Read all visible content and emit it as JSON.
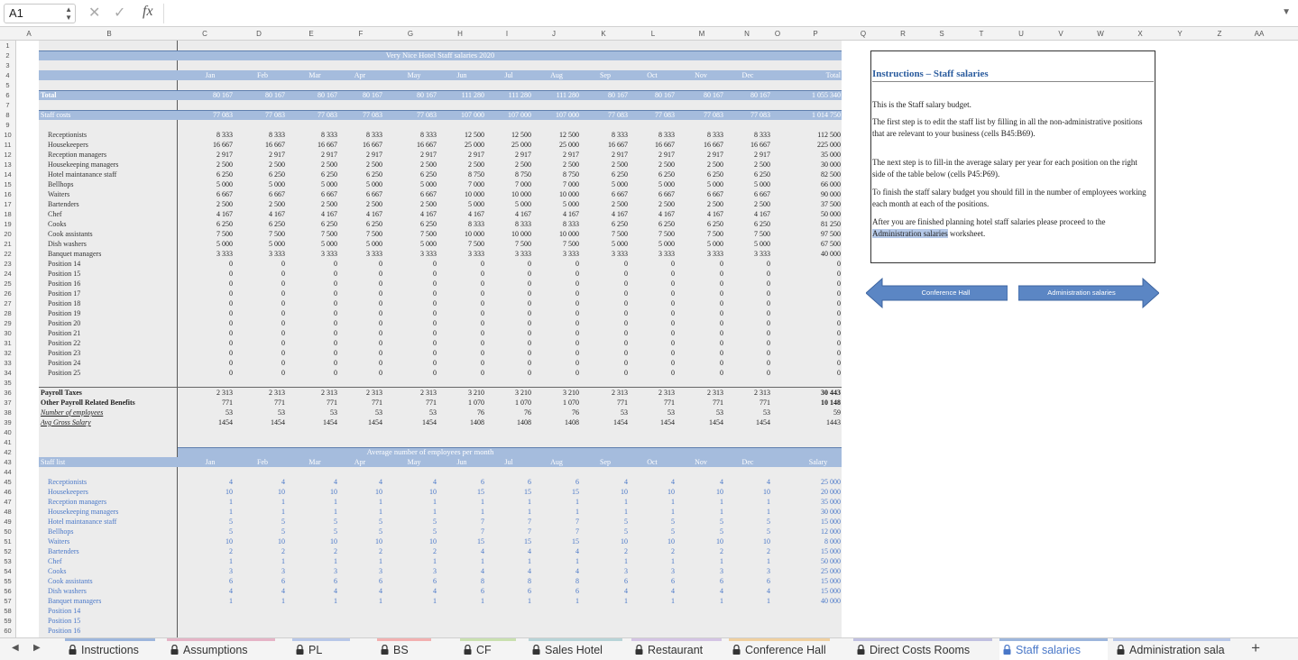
{
  "formula_bar": {
    "cell_ref": "A1",
    "formula": ""
  },
  "columns": [
    "A",
    "B",
    "C",
    "D",
    "E",
    "F",
    "G",
    "H",
    "I",
    "J",
    "K",
    "L",
    "M",
    "N",
    "O",
    "P",
    "Q",
    "R",
    "S",
    "T",
    "U",
    "V",
    "W",
    "X",
    "Y",
    "Z",
    "AA"
  ],
  "budget": {
    "title": "Very Nice Hotel Staff salaries 2020",
    "months": [
      "Jan",
      "Feb",
      "Mar",
      "Apr",
      "May",
      "Jun",
      "Jul",
      "Aug",
      "Sep",
      "Oct",
      "Nov",
      "Dec",
      "Total"
    ],
    "total_label": "Total",
    "total_values": [
      "80 167",
      "80 167",
      "80 167",
      "80 167",
      "80 167",
      "111 280",
      "111 280",
      "111 280",
      "80 167",
      "80 167",
      "80 167",
      "80 167",
      "1 055 340"
    ],
    "staff_costs_label": "Staff costs",
    "staff_costs_values": [
      "77 083",
      "77 083",
      "77 083",
      "77 083",
      "77 083",
      "107 000",
      "107 000",
      "107 000",
      "77 083",
      "77 083",
      "77 083",
      "77 083",
      "1 014 750"
    ],
    "rows": [
      {
        "label": "Receptionists",
        "v": [
          "8 333",
          "8 333",
          "8 333",
          "8 333",
          "8 333",
          "12 500",
          "12 500",
          "12 500",
          "8 333",
          "8 333",
          "8 333",
          "8 333",
          "112 500"
        ]
      },
      {
        "label": "Housekeepers",
        "v": [
          "16 667",
          "16 667",
          "16 667",
          "16 667",
          "16 667",
          "25 000",
          "25 000",
          "25 000",
          "16 667",
          "16 667",
          "16 667",
          "16 667",
          "225 000"
        ]
      },
      {
        "label": "Reception managers",
        "v": [
          "2 917",
          "2 917",
          "2 917",
          "2 917",
          "2 917",
          "2 917",
          "2 917",
          "2 917",
          "2 917",
          "2 917",
          "2 917",
          "2 917",
          "35 000"
        ]
      },
      {
        "label": "Housekeeping managers",
        "v": [
          "2 500",
          "2 500",
          "2 500",
          "2 500",
          "2 500",
          "2 500",
          "2 500",
          "2 500",
          "2 500",
          "2 500",
          "2 500",
          "2 500",
          "30 000"
        ]
      },
      {
        "label": "Hotel maintanance staff",
        "v": [
          "6 250",
          "6 250",
          "6 250",
          "6 250",
          "6 250",
          "8 750",
          "8 750",
          "8 750",
          "6 250",
          "6 250",
          "6 250",
          "6 250",
          "82 500"
        ]
      },
      {
        "label": "Bellhops",
        "v": [
          "5 000",
          "5 000",
          "5 000",
          "5 000",
          "5 000",
          "7 000",
          "7 000",
          "7 000",
          "5 000",
          "5 000",
          "5 000",
          "5 000",
          "66 000"
        ]
      },
      {
        "label": "Waiters",
        "v": [
          "6 667",
          "6 667",
          "6 667",
          "6 667",
          "6 667",
          "10 000",
          "10 000",
          "10 000",
          "6 667",
          "6 667",
          "6 667",
          "6 667",
          "90 000"
        ]
      },
      {
        "label": "Bartenders",
        "v": [
          "2 500",
          "2 500",
          "2 500",
          "2 500",
          "2 500",
          "5 000",
          "5 000",
          "5 000",
          "2 500",
          "2 500",
          "2 500",
          "2 500",
          "37 500"
        ]
      },
      {
        "label": "Chef",
        "v": [
          "4 167",
          "4 167",
          "4 167",
          "4 167",
          "4 167",
          "4 167",
          "4 167",
          "4 167",
          "4 167",
          "4 167",
          "4 167",
          "4 167",
          "50 000"
        ]
      },
      {
        "label": "Cooks",
        "v": [
          "6 250",
          "6 250",
          "6 250",
          "6 250",
          "6 250",
          "8 333",
          "8 333",
          "8 333",
          "6 250",
          "6 250",
          "6 250",
          "6 250",
          "81 250"
        ]
      },
      {
        "label": "Cook assistants",
        "v": [
          "7 500",
          "7 500",
          "7 500",
          "7 500",
          "7 500",
          "10 000",
          "10 000",
          "10 000",
          "7 500",
          "7 500",
          "7 500",
          "7 500",
          "97 500"
        ]
      },
      {
        "label": "Dish washers",
        "v": [
          "5 000",
          "5 000",
          "5 000",
          "5 000",
          "5 000",
          "7 500",
          "7 500",
          "7 500",
          "5 000",
          "5 000",
          "5 000",
          "5 000",
          "67 500"
        ]
      },
      {
        "label": "Banquet managers",
        "v": [
          "3 333",
          "3 333",
          "3 333",
          "3 333",
          "3 333",
          "3 333",
          "3 333",
          "3 333",
          "3 333",
          "3 333",
          "3 333",
          "3 333",
          "40 000"
        ]
      },
      {
        "label": "Position 14",
        "v": [
          "0",
          "0",
          "0",
          "0",
          "0",
          "0",
          "0",
          "0",
          "0",
          "0",
          "0",
          "0",
          "0"
        ]
      },
      {
        "label": "Position 15",
        "v": [
          "0",
          "0",
          "0",
          "0",
          "0",
          "0",
          "0",
          "0",
          "0",
          "0",
          "0",
          "0",
          "0"
        ]
      },
      {
        "label": "Position 16",
        "v": [
          "0",
          "0",
          "0",
          "0",
          "0",
          "0",
          "0",
          "0",
          "0",
          "0",
          "0",
          "0",
          "0"
        ]
      },
      {
        "label": "Position 17",
        "v": [
          "0",
          "0",
          "0",
          "0",
          "0",
          "0",
          "0",
          "0",
          "0",
          "0",
          "0",
          "0",
          "0"
        ]
      },
      {
        "label": "Position 18",
        "v": [
          "0",
          "0",
          "0",
          "0",
          "0",
          "0",
          "0",
          "0",
          "0",
          "0",
          "0",
          "0",
          "0"
        ]
      },
      {
        "label": "Position 19",
        "v": [
          "0",
          "0",
          "0",
          "0",
          "0",
          "0",
          "0",
          "0",
          "0",
          "0",
          "0",
          "0",
          "0"
        ]
      },
      {
        "label": "Position 20",
        "v": [
          "0",
          "0",
          "0",
          "0",
          "0",
          "0",
          "0",
          "0",
          "0",
          "0",
          "0",
          "0",
          "0"
        ]
      },
      {
        "label": "Position 21",
        "v": [
          "0",
          "0",
          "0",
          "0",
          "0",
          "0",
          "0",
          "0",
          "0",
          "0",
          "0",
          "0",
          "0"
        ]
      },
      {
        "label": "Position 22",
        "v": [
          "0",
          "0",
          "0",
          "0",
          "0",
          "0",
          "0",
          "0",
          "0",
          "0",
          "0",
          "0",
          "0"
        ]
      },
      {
        "label": "Position 23",
        "v": [
          "0",
          "0",
          "0",
          "0",
          "0",
          "0",
          "0",
          "0",
          "0",
          "0",
          "0",
          "0",
          "0"
        ]
      },
      {
        "label": "Position 24",
        "v": [
          "0",
          "0",
          "0",
          "0",
          "0",
          "0",
          "0",
          "0",
          "0",
          "0",
          "0",
          "0",
          "0"
        ]
      },
      {
        "label": "Position 25",
        "v": [
          "0",
          "0",
          "0",
          "0",
          "0",
          "0",
          "0",
          "0",
          "0",
          "0",
          "0",
          "0",
          "0"
        ]
      }
    ],
    "summary": [
      {
        "label": "Payroll Taxes",
        "style": "bold",
        "v": [
          "2 313",
          "2 313",
          "2 313",
          "2 313",
          "2 313",
          "3 210",
          "3 210",
          "3 210",
          "2 313",
          "2 313",
          "2 313",
          "2 313",
          "30 443"
        ]
      },
      {
        "label": "Other Payroll Related Benefits",
        "style": "bold",
        "v": [
          "771",
          "771",
          "771",
          "771",
          "771",
          "1 070",
          "1 070",
          "1 070",
          "771",
          "771",
          "771",
          "771",
          "10 148"
        ]
      },
      {
        "label": "Number of employees",
        "style": "ital",
        "v": [
          "53",
          "53",
          "53",
          "53",
          "53",
          "76",
          "76",
          "76",
          "53",
          "53",
          "53",
          "53",
          "59"
        ]
      },
      {
        "label": "Avg Gross Salary",
        "style": "ital",
        "v": [
          "1454",
          "1454",
          "1454",
          "1454",
          "1454",
          "1408",
          "1408",
          "1408",
          "1454",
          "1454",
          "1454",
          "1454",
          "1443"
        ]
      }
    ]
  },
  "staff_list": {
    "title": "Average number of employees per month",
    "label": "Staff list",
    "headers": [
      "Jan",
      "Feb",
      "Mar",
      "Apr",
      "May",
      "Jun",
      "Jul",
      "Aug",
      "Sep",
      "Oct",
      "Nov",
      "Dec",
      "Salary"
    ],
    "rows": [
      {
        "label": "Receptionists",
        "v": [
          "4",
          "4",
          "4",
          "4",
          "4",
          "6",
          "6",
          "6",
          "4",
          "4",
          "4",
          "4",
          "25 000"
        ]
      },
      {
        "label": "Housekeepers",
        "v": [
          "10",
          "10",
          "10",
          "10",
          "10",
          "15",
          "15",
          "15",
          "10",
          "10",
          "10",
          "10",
          "20 000"
        ]
      },
      {
        "label": "Reception managers",
        "v": [
          "1",
          "1",
          "1",
          "1",
          "1",
          "1",
          "1",
          "1",
          "1",
          "1",
          "1",
          "1",
          "35 000"
        ]
      },
      {
        "label": "Housekeeping managers",
        "v": [
          "1",
          "1",
          "1",
          "1",
          "1",
          "1",
          "1",
          "1",
          "1",
          "1",
          "1",
          "1",
          "30 000"
        ]
      },
      {
        "label": "Hotel maintanance staff",
        "v": [
          "5",
          "5",
          "5",
          "5",
          "5",
          "7",
          "7",
          "7",
          "5",
          "5",
          "5",
          "5",
          "15 000"
        ]
      },
      {
        "label": "Bellhops",
        "v": [
          "5",
          "5",
          "5",
          "5",
          "5",
          "7",
          "7",
          "7",
          "5",
          "5",
          "5",
          "5",
          "12 000"
        ]
      },
      {
        "label": "Waiters",
        "v": [
          "10",
          "10",
          "10",
          "10",
          "10",
          "15",
          "15",
          "15",
          "10",
          "10",
          "10",
          "10",
          "8 000"
        ]
      },
      {
        "label": "Bartenders",
        "v": [
          "2",
          "2",
          "2",
          "2",
          "2",
          "4",
          "4",
          "4",
          "2",
          "2",
          "2",
          "2",
          "15 000"
        ]
      },
      {
        "label": "Chef",
        "v": [
          "1",
          "1",
          "1",
          "1",
          "1",
          "1",
          "1",
          "1",
          "1",
          "1",
          "1",
          "1",
          "50 000"
        ]
      },
      {
        "label": "Cooks",
        "v": [
          "3",
          "3",
          "3",
          "3",
          "3",
          "4",
          "4",
          "4",
          "3",
          "3",
          "3",
          "3",
          "25 000"
        ]
      },
      {
        "label": "Cook assistants",
        "v": [
          "6",
          "6",
          "6",
          "6",
          "6",
          "8",
          "8",
          "8",
          "6",
          "6",
          "6",
          "6",
          "15 000"
        ]
      },
      {
        "label": "Dish washers",
        "v": [
          "4",
          "4",
          "4",
          "4",
          "4",
          "6",
          "6",
          "6",
          "4",
          "4",
          "4",
          "4",
          "15 000"
        ]
      },
      {
        "label": "Banquet managers",
        "v": [
          "1",
          "1",
          "1",
          "1",
          "1",
          "1",
          "1",
          "1",
          "1",
          "1",
          "1",
          "1",
          "40 000"
        ]
      },
      {
        "label": "Position 14",
        "v": [
          "",
          "",
          "",
          "",
          "",
          "",
          "",
          "",
          "",
          "",
          "",
          "",
          ""
        ]
      },
      {
        "label": "Position 15",
        "v": [
          "",
          "",
          "",
          "",
          "",
          "",
          "",
          "",
          "",
          "",
          "",
          "",
          ""
        ]
      },
      {
        "label": "Position 16",
        "v": [
          "",
          "",
          "",
          "",
          "",
          "",
          "",
          "",
          "",
          "",
          "",
          "",
          ""
        ]
      }
    ]
  },
  "instructions": {
    "title": "Instructions – Staff salaries",
    "p1": "This is the Staff salary budget.",
    "p2": "The first step is to edit the staff list by filling in all the non-administrative positions that are relevant to your business (cells B45:B69).",
    "p3": "The next step is to fill-in the average salary per year for each position on the right side of the table below (cells P45:P69).",
    "p4": "To finish the staff salary budget you should fill in the number of employees working each month at each of the positions.",
    "p5_before": "After you are finished planning hotel staff salaries please proceed to the ",
    "p5_link": "Administration salaries",
    "p5_after": " worksheet."
  },
  "nav": {
    "prev_label": "Conference Hall",
    "next_label": "Administration salaries"
  },
  "tabs": [
    "Instructions",
    "Assumptions",
    "PL",
    "BS",
    "CF",
    "Sales Hotel",
    "Restaurant",
    "Conference Hall",
    "Direct Costs Rooms",
    "Staff salaries",
    "Administration sala"
  ],
  "active_tab": "Staff salaries",
  "colors": {
    "header_band": "#a5bcdd",
    "accent": "#4a78c8",
    "arrow_fill": "#5b86c4"
  }
}
